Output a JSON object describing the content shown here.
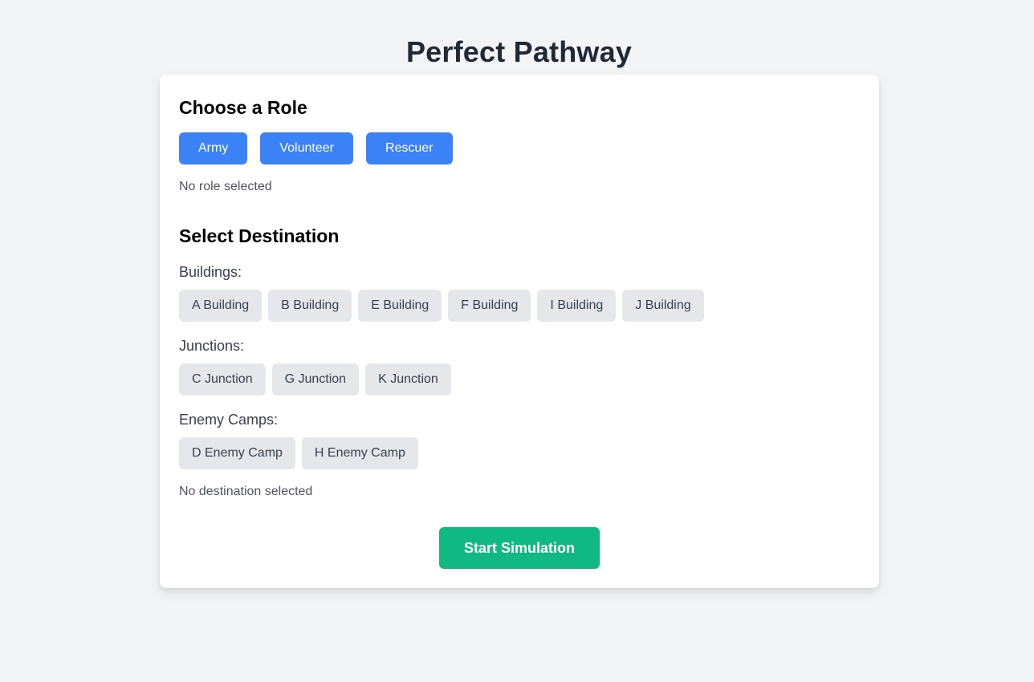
{
  "app": {
    "title": "Perfect Pathway"
  },
  "role_section": {
    "heading": "Choose a Role",
    "roles": [
      "Army",
      "Volunteer",
      "Rescuer"
    ],
    "status": "No role selected"
  },
  "destination_section": {
    "heading": "Select Destination",
    "groups": [
      {
        "label": "Buildings:",
        "items": [
          "A Building",
          "B Building",
          "E Building",
          "F Building",
          "I Building",
          "J Building"
        ]
      },
      {
        "label": "Junctions:",
        "items": [
          "C Junction",
          "G Junction",
          "K Junction"
        ]
      },
      {
        "label": "Enemy Camps:",
        "items": [
          "D Enemy Camp",
          "H Enemy Camp"
        ]
      }
    ],
    "status": "No destination selected"
  },
  "actions": {
    "start_label": "Start Simulation"
  },
  "colors": {
    "role_button": "#3b82f6",
    "destination_button": "#e5e7eb",
    "start_button": "#10b981",
    "background": "#f3f4f6"
  }
}
